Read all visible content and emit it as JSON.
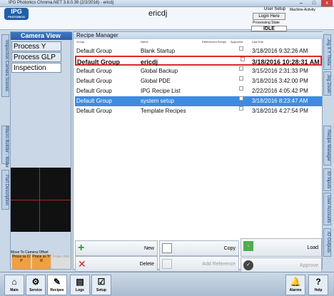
{
  "titlebar": {
    "title": "IPG Photonics Chroma.NET 3.8.0.39 (2/2/2016)  -  ericdj",
    "min": "–",
    "max": "□",
    "close": "x"
  },
  "header": {
    "logo": "IPG",
    "logo_sub": "PHOTONICS",
    "user": "ericdj",
    "user_setup": "User Setup",
    "login_btn": "Login Here",
    "machine_activity": "Machine Activity",
    "processing_state_label": "Processing State",
    "processing_state": "IDLE"
  },
  "left_tabs": [
    "Inspection Camera Scenes",
    "Macro Builder - Water",
    "Part Description"
  ],
  "right_tabs": [
    "Jog X Y Theta",
    "Jog Zoom",
    "Recipe Manager",
    "IO Inputs",
    "User Accounts",
    "IO Outputs"
  ],
  "camera_panel": {
    "title": "Camera View",
    "modes": [
      "Process Y",
      "Process GLP",
      "Inspection"
    ],
    "move_offset": "Move To Camera Offset",
    "btn1": "Proce ss C/ P",
    "btn2": "Proce ss Y/ R",
    "btn3": "Inspe ction"
  },
  "recipe": {
    "title": "Recipe Manager",
    "columns": [
      "Group",
      "Name",
      "Referenced Recipe",
      "Approved",
      "Last Edit"
    ],
    "rows": [
      {
        "group": "Default Group",
        "name": "Blank Startup",
        "edit": "3/18/2016 9:32:26 AM"
      },
      {
        "group": "Default Group",
        "name": "ericdj",
        "edit": "3/18/2016 10:28:31 AM"
      },
      {
        "group": "Default Group",
        "name": "Global Backup",
        "edit": "3/15/2016 2:31:33 PM"
      },
      {
        "group": "Default Group",
        "name": "Global PDE",
        "edit": "3/18/2016 3:42:00 PM"
      },
      {
        "group": "Default Group",
        "name": "IPG Recipe List",
        "edit": "2/22/2016 4:05:42 PM"
      },
      {
        "group": "Default Group",
        "name": "system setup",
        "edit": "3/18/2016 8:23:47 AM"
      },
      {
        "group": "Default Group",
        "name": "Template Recipes",
        "edit": "3/18/2016 4:27:54 PM"
      }
    ],
    "buttons": {
      "new": "New",
      "copy": "Copy",
      "load": "Load",
      "delete": "Delete",
      "add_ref": "Add Reference",
      "approve": "Approve"
    }
  },
  "bottom": [
    "Main",
    "Service",
    "Recipes",
    "Logs",
    "Setup",
    "Alarms",
    "Help"
  ]
}
